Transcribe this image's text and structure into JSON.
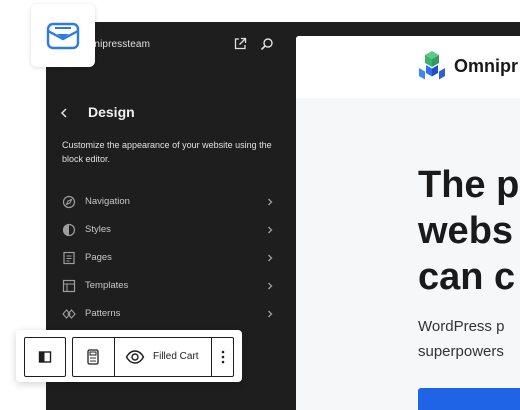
{
  "site_hub": {
    "site_title": "mnipressteam",
    "external_link_icon": "external-link-icon",
    "search_icon": "search-icon"
  },
  "design_panel": {
    "title": "Design",
    "description": "Customize the appearance of your website using the block editor.",
    "menu": [
      {
        "label": "Navigation",
        "icon": "navigation-icon"
      },
      {
        "label": "Styles",
        "icon": "styles-icon"
      },
      {
        "label": "Pages",
        "icon": "pages-icon"
      },
      {
        "label": "Templates",
        "icon": "templates-icon"
      },
      {
        "label": "Patterns",
        "icon": "patterns-icon"
      }
    ]
  },
  "preview": {
    "brand": "Omnipr",
    "hero_title": "The p\nwebs\ncan c",
    "hero_subtitle": "WordPress p\nsuperpowers",
    "colors": {
      "cta": "#1f63e6",
      "logo_green": "#3bb36b",
      "logo_blue": "#2d6ff0"
    }
  },
  "block_toolbar": {
    "block_type_icon": "sidebar-layout-icon",
    "calculator_icon": "calculator-icon",
    "visibility_icon": "eye-icon",
    "cart_state_label": "Filled Cart",
    "more_icon": "more-vertical-icon"
  },
  "site_icon": {
    "icon": "mail-icon",
    "color": "#2c7be5"
  }
}
